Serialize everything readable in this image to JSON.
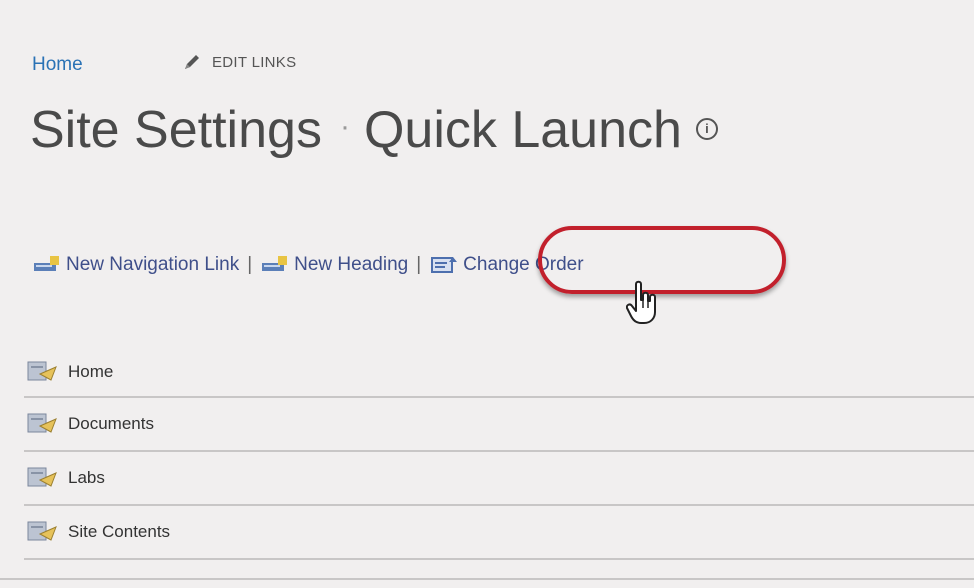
{
  "topnav": {
    "home_link": "Home",
    "edit_links": "EDIT LINKS"
  },
  "title": {
    "main": "Site Settings",
    "separator": "·",
    "sub": "Quick Launch",
    "info_symbol": "i"
  },
  "toolbar": {
    "new_navigation_link": "New Navigation Link",
    "separator": "|",
    "new_heading": "New Heading",
    "change_order": "Change Order"
  },
  "highlight": {
    "color": "#c2202c"
  },
  "nav_items": [
    {
      "label": "Home",
      "icon": "page-icon"
    },
    {
      "label": "Documents",
      "icon": "page-icon"
    },
    {
      "label": "Labs",
      "icon": "page-icon"
    },
    {
      "label": "Site Contents",
      "icon": "page-icon"
    }
  ]
}
